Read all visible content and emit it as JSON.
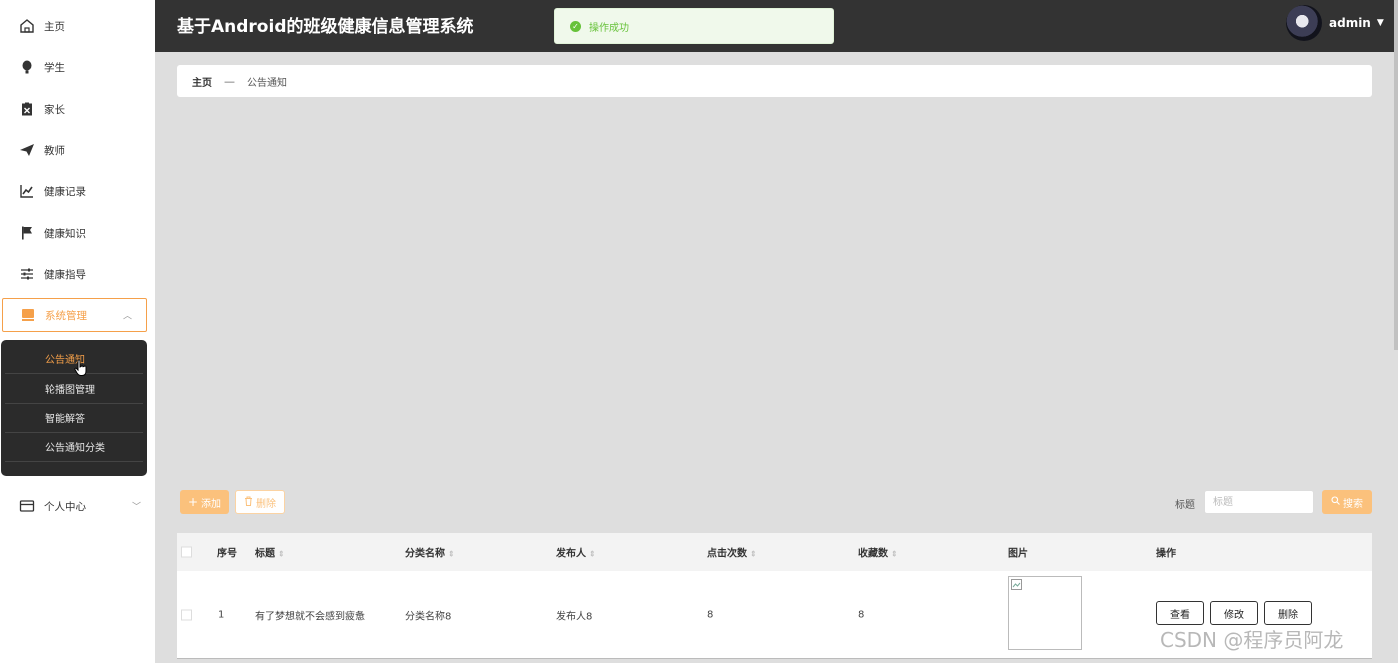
{
  "app": {
    "title": "基于Android的班级健康信息管理系统"
  },
  "toast": {
    "message": "操作成功"
  },
  "user": {
    "name": "admin"
  },
  "sidebar": {
    "items": [
      {
        "label": "主页",
        "icon": "home-icon"
      },
      {
        "label": "学生",
        "icon": "bulb-icon"
      },
      {
        "label": "家长",
        "icon": "clipboard-icon"
      },
      {
        "label": "教师",
        "icon": "send-icon"
      },
      {
        "label": "健康记录",
        "icon": "chart-icon"
      },
      {
        "label": "健康知识",
        "icon": "flag-icon"
      },
      {
        "label": "健康指导",
        "icon": "sliders-icon"
      },
      {
        "label": "系统管理",
        "icon": "monitor-icon"
      },
      {
        "label": "个人中心",
        "icon": "card-icon"
      }
    ],
    "submenu": [
      "公告通知",
      "轮播图管理",
      "智能解答",
      "公告通知分类"
    ]
  },
  "breadcrumb": {
    "home": "主页",
    "separator": "—",
    "current": "公告通知"
  },
  "toolbar": {
    "add_label": "添加",
    "delete_label": "删除",
    "search_label": "标题",
    "search_placeholder": "标题",
    "search_button": "搜索"
  },
  "table": {
    "headers": [
      "序号",
      "标题",
      "分类名称",
      "发布人",
      "点击次数",
      "收藏数",
      "图片",
      "操作"
    ],
    "rows": [
      {
        "index": "1",
        "title": "有了梦想就不会感到疲惫",
        "category": "分类名称8",
        "publisher": "发布人8",
        "clicks": "8",
        "favorites": "8"
      }
    ],
    "actions": [
      "查看",
      "修改",
      "删除"
    ]
  },
  "watermark": "CSDN @程序员阿龙",
  "colors": {
    "accent": "#f5a04a",
    "header_bg": "#333333",
    "success": "#67c23a"
  }
}
